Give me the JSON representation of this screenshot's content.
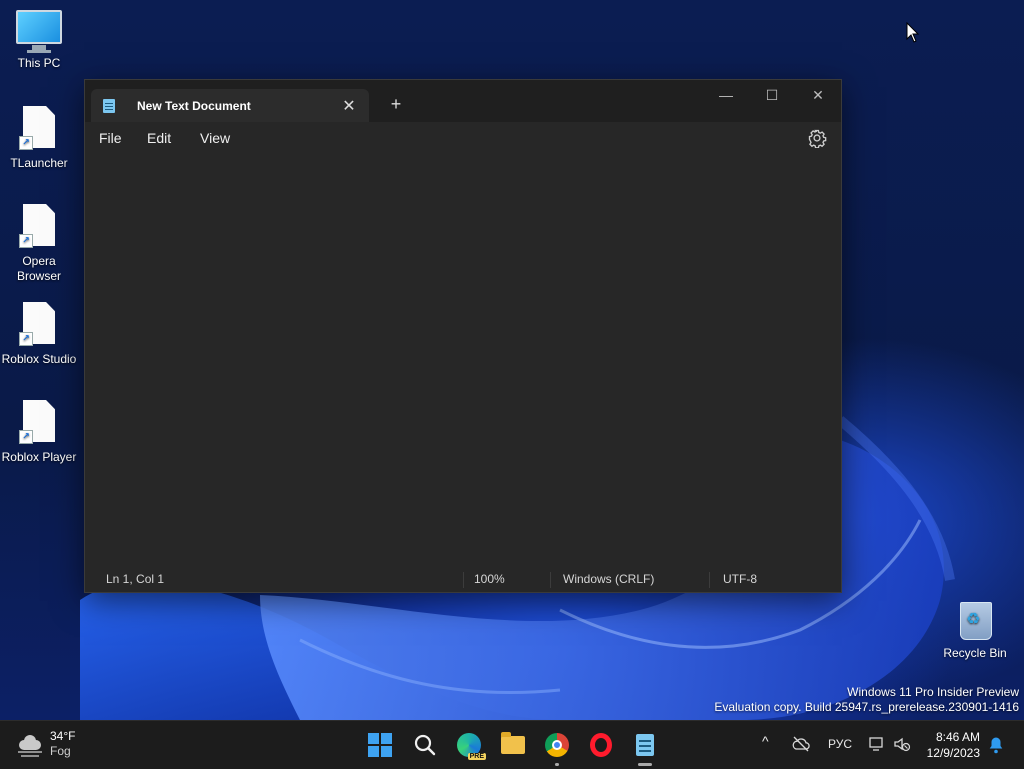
{
  "desktop": {
    "icons": [
      {
        "label": "This PC"
      },
      {
        "label": "TLauncher"
      },
      {
        "label": "Opera Browser"
      },
      {
        "label": "Roblox Studio"
      },
      {
        "label": "Roblox Player"
      },
      {
        "label": "Recycle Bin"
      }
    ],
    "watermark": {
      "line1": "Windows 11 Pro Insider Preview",
      "line2": "Evaluation copy. Build 25947.rs_prerelease.230901-1416"
    }
  },
  "notepad": {
    "tab_title": "New Text Document",
    "tab_close_glyph": "✕",
    "new_tab_glyph": "+",
    "window_controls": {
      "minimize": "—",
      "maximize": "☐",
      "close": "✕"
    },
    "menu": {
      "file": "File",
      "edit": "Edit",
      "view": "View"
    },
    "settings_icon": "gear-icon",
    "content": "",
    "status": {
      "position": "Ln 1, Col 1",
      "zoom": "100%",
      "line_ending": "Windows (CRLF)",
      "encoding": "UTF-8"
    }
  },
  "taskbar": {
    "weather": {
      "temp": "34°F",
      "condition": "Fog"
    },
    "apps": [
      "start-icon",
      "search-icon",
      "edge-preview-icon",
      "file-explorer-icon",
      "chrome-icon",
      "opera-icon",
      "notepad-icon"
    ],
    "tray": {
      "chevron": "^",
      "language": "РУС"
    },
    "clock": {
      "time": "8:46 AM",
      "date": "12/9/2023"
    }
  },
  "colors": {
    "window_bg": "#272727",
    "titlebar_bg": "#1f1f1f",
    "taskbar_bg": "#1c1c1c",
    "accent": "#3ea3f2"
  }
}
